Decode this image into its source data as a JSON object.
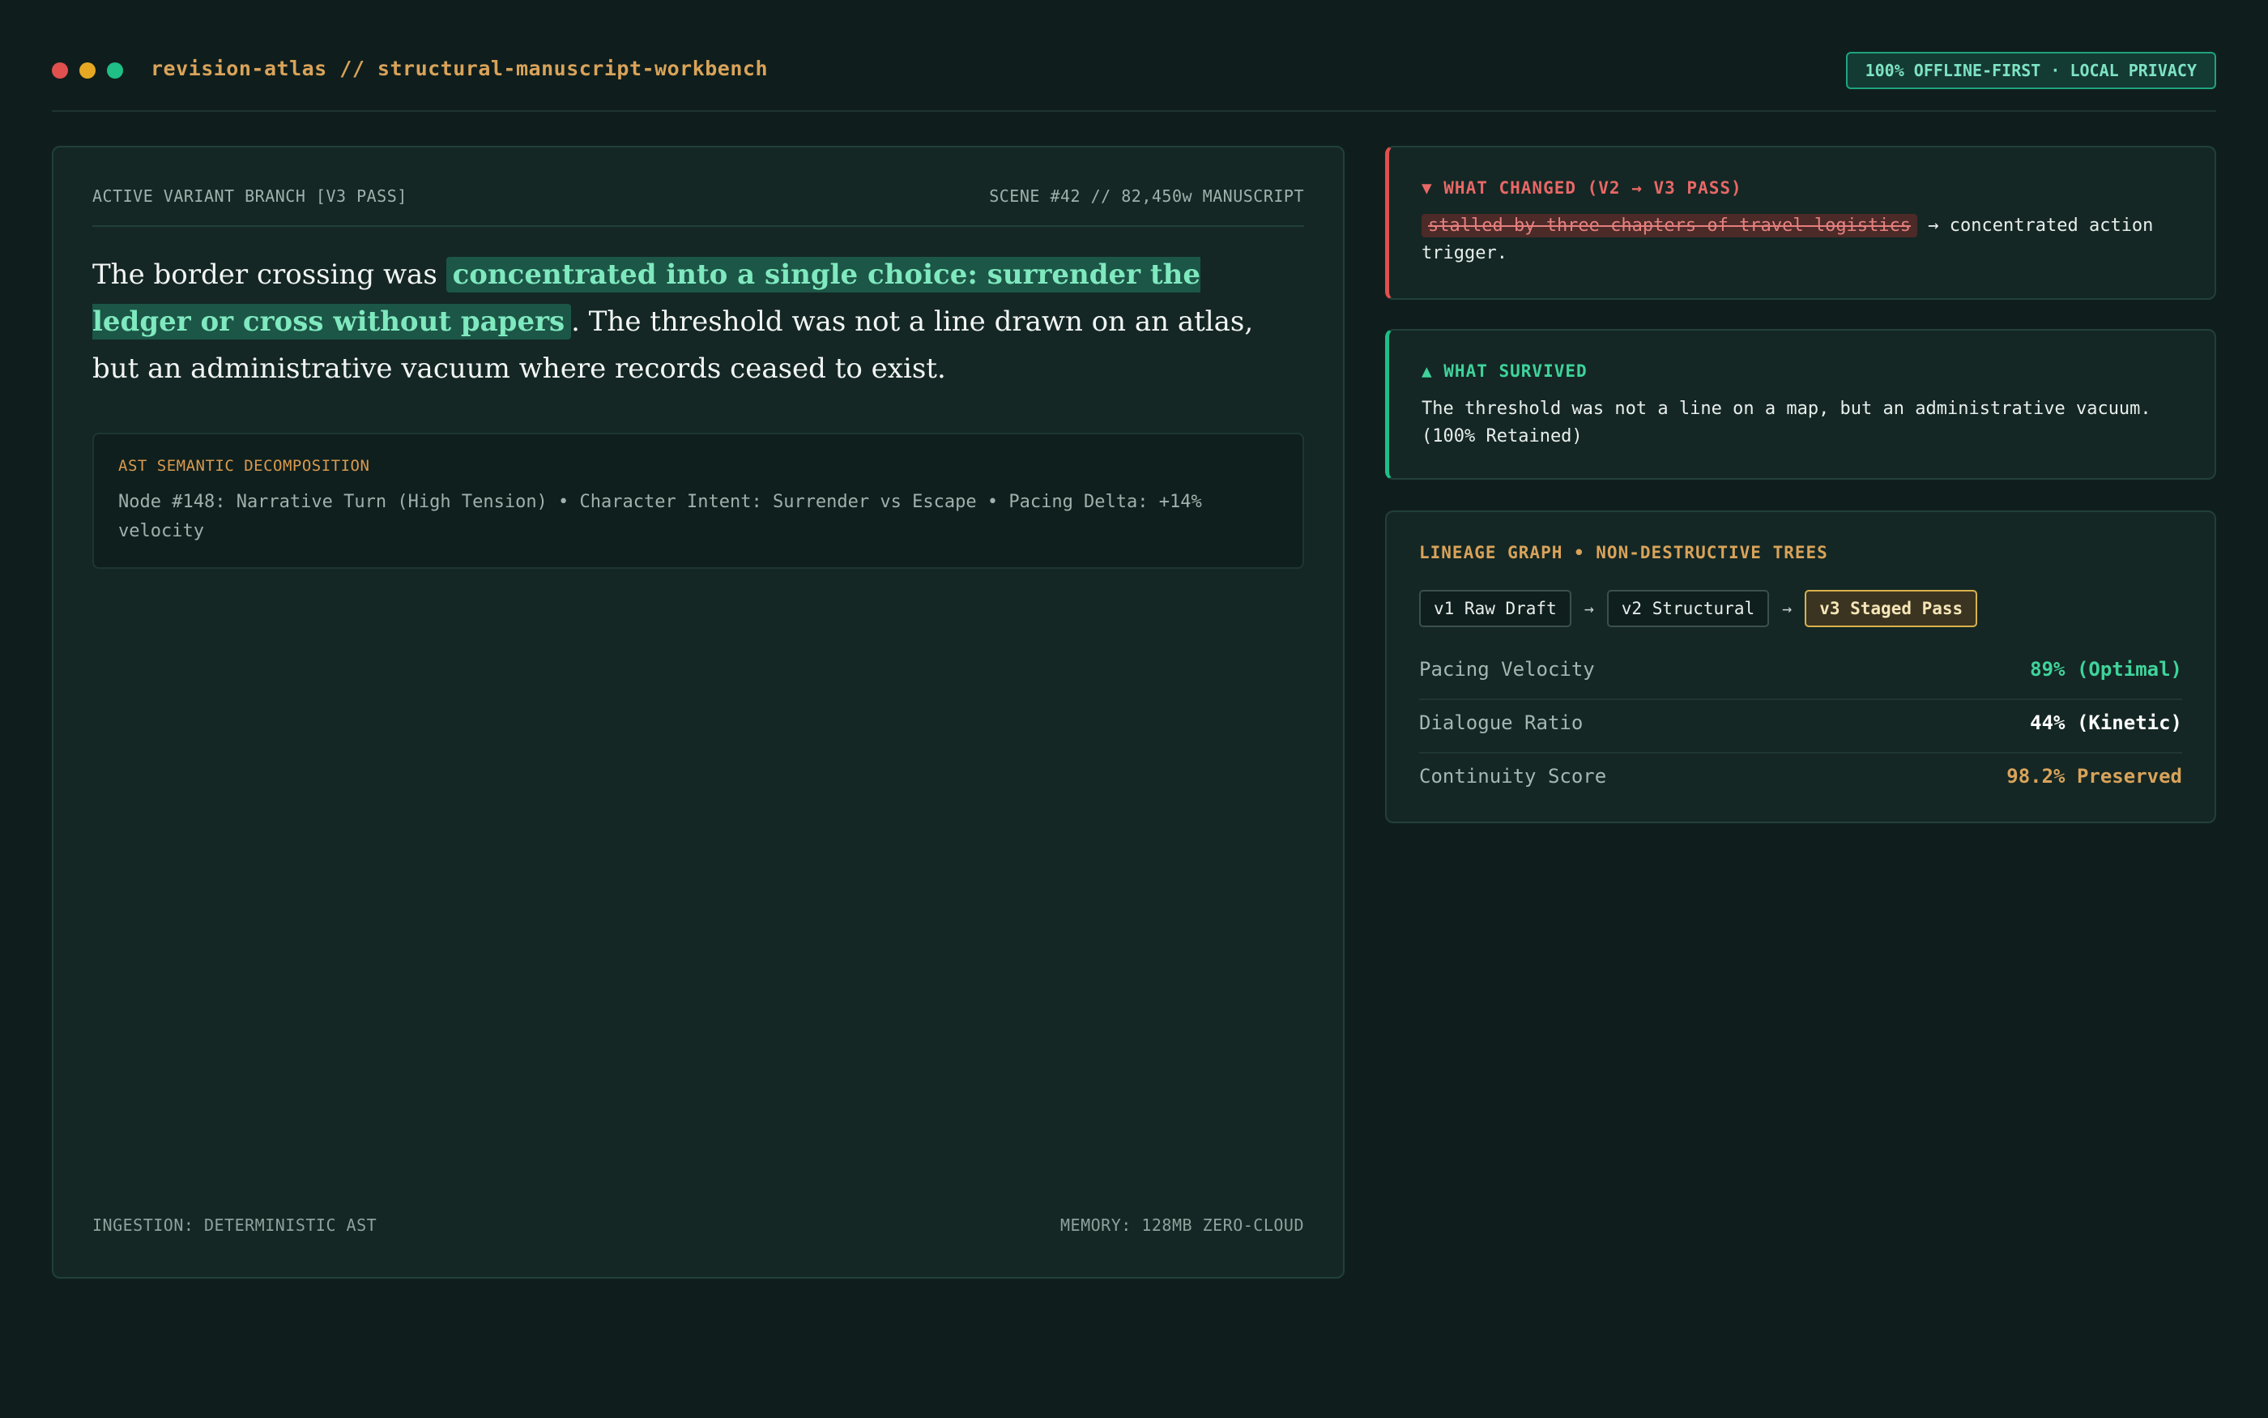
{
  "header": {
    "title": "revision-atlas // structural-manuscript-workbench",
    "badge": "100% OFFLINE-FIRST · LOCAL PRIVACY"
  },
  "editor": {
    "branch_label": "ACTIVE VARIANT BRANCH [V3 PASS]",
    "scene_label": "SCENE #42 // 82,450w MANUSCRIPT",
    "prose_before": "The border crossing was ",
    "prose_highlight": "concentrated into a single choice: surrender the ledger or cross without papers",
    "prose_after": ". The threshold was not a line drawn on an atlas, but an administrative vacuum where records ceased to exist.",
    "ast_title": "AST SEMANTIC DECOMPOSITION",
    "ast_text": "Node #148: Narrative Turn (High Tension) • Character Intent: Surrender vs Escape • Pacing Delta: +14% velocity",
    "footer_left": "INGESTION: DETERMINISTIC AST",
    "footer_right": "MEMORY: 128MB ZERO-CLOUD"
  },
  "changed": {
    "title": "▼ WHAT CHANGED (V2 → V3 PASS)",
    "removed": "stalled by three chapters of travel logistics",
    "added": " → concentrated action trigger."
  },
  "survived": {
    "title": "▲ WHAT SURVIVED",
    "text": "The threshold was not a line on a map, but an administrative vacuum. (100% Retained)"
  },
  "lineage": {
    "title": "LINEAGE GRAPH • NON-DESTRUCTIVE TREES",
    "versions": [
      "v1 Raw Draft",
      "v2 Structural",
      "v3 Staged Pass"
    ],
    "arrow": "→",
    "metrics": [
      {
        "label": "Pacing Velocity",
        "value": "89% (Optimal)",
        "color": "#3fd39b"
      },
      {
        "label": "Dialogue Ratio",
        "value": "44% (Kinetic)",
        "color": "#ffffff"
      },
      {
        "label": "Continuity Score",
        "value": "98.2% Preserved",
        "color": "#d9a35a"
      }
    ]
  }
}
